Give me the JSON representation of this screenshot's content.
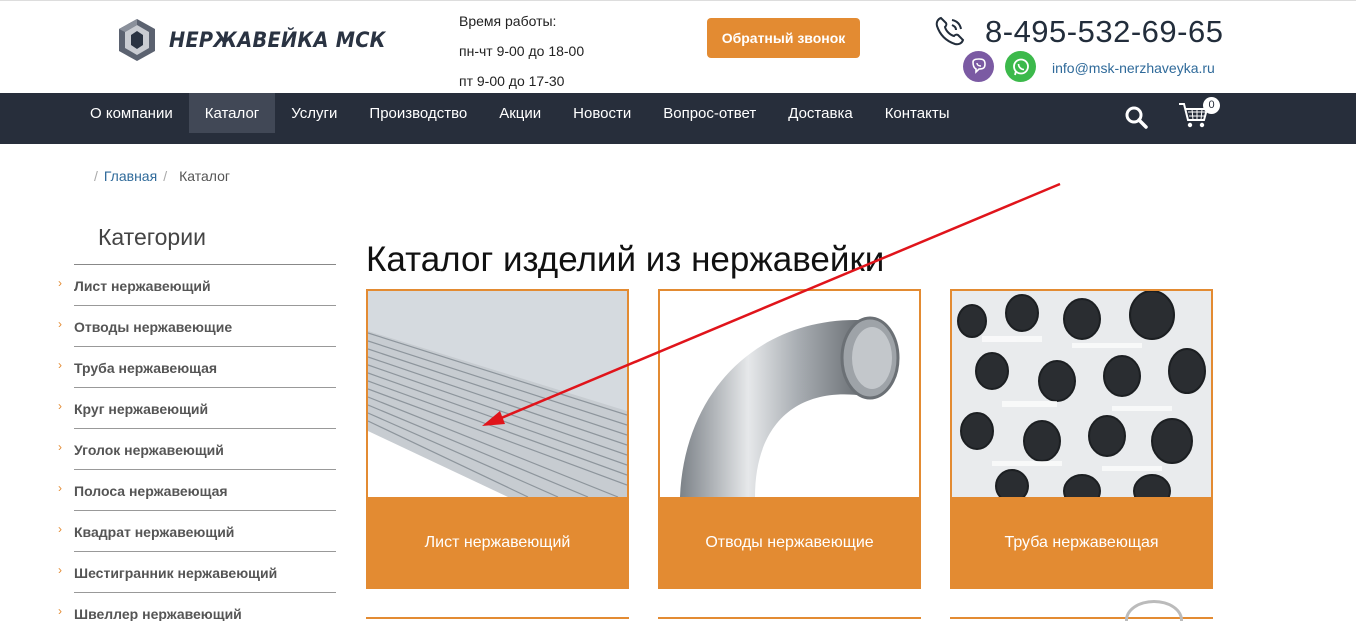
{
  "header": {
    "logo_text": "НЕРЖАВЕЙКА МСК",
    "hours_title": "Время работы:",
    "hours_weekdays": "пн-чт 9-00 до 18-00",
    "hours_friday": "пт 9-00 до 17-30",
    "callback_label": "Обратный звонок",
    "phone": "8-495-532-69-65",
    "email": "info@msk-nerzhaveyka.ru",
    "icons": [
      "logo-icon",
      "phone-icon",
      "viber-icon",
      "whatsapp-icon"
    ]
  },
  "nav": {
    "items": [
      {
        "label": "О компании"
      },
      {
        "label": "Каталог",
        "active": true
      },
      {
        "label": "Услуги"
      },
      {
        "label": "Производство"
      },
      {
        "label": "Акции"
      },
      {
        "label": "Новости"
      },
      {
        "label": "Вопрос-ответ"
      },
      {
        "label": "Доставка"
      },
      {
        "label": "Контакты"
      }
    ],
    "cart_count": "0",
    "icons": [
      "search-icon",
      "cart-icon"
    ]
  },
  "breadcrumb": {
    "home": "Главная",
    "current": "Каталог"
  },
  "sidebar": {
    "title": "Категории",
    "items": [
      {
        "label": "Лист нержавеющий"
      },
      {
        "label": "Отводы нержавеющие"
      },
      {
        "label": "Труба нержавеющая"
      },
      {
        "label": "Круг нержавеющий"
      },
      {
        "label": "Уголок нержавеющий"
      },
      {
        "label": "Полоса нержавеющая"
      },
      {
        "label": "Квадрат нержавеющий"
      },
      {
        "label": "Шестигранник нержавеющий"
      },
      {
        "label": "Швеллер нержавеющий"
      }
    ]
  },
  "main": {
    "title": "Каталог изделий из нержавейки",
    "cards": [
      {
        "label": "Лист нержавеющий"
      },
      {
        "label": "Отводы нержавеющие"
      },
      {
        "label": "Труба нержавеющая"
      }
    ]
  },
  "colors": {
    "accent": "#e38b32",
    "nav_bg": "#272e3b",
    "link": "#2f6a9a",
    "annotation_arrow": "#e0141b"
  }
}
